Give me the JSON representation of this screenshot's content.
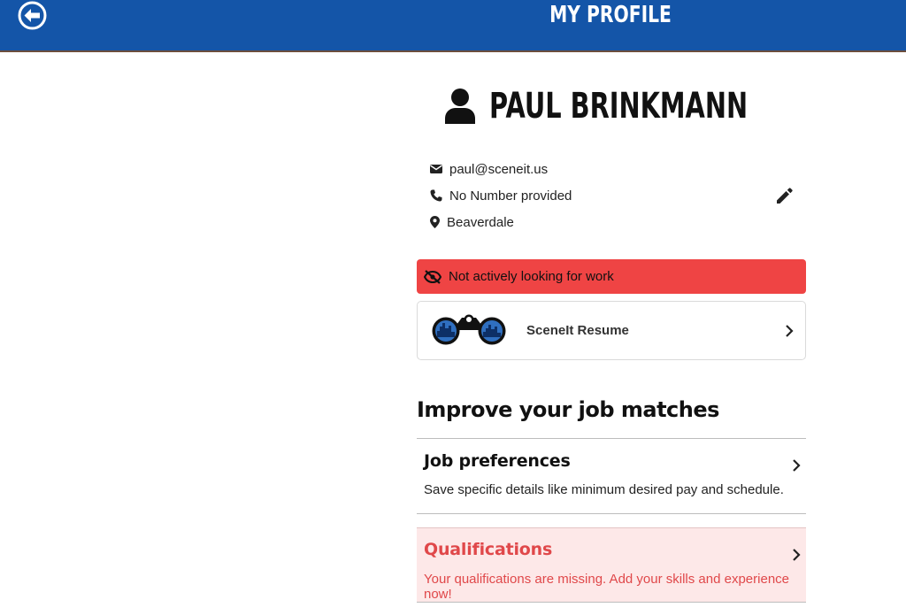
{
  "header": {
    "title": "MY PROFILE"
  },
  "profile": {
    "name": "PAUL BRINKMANN",
    "email": "paul@sceneit.us",
    "phone": "No Number provided",
    "location": "Beaverdale"
  },
  "status": {
    "label": "Not actively looking for work",
    "color": "#ef4444"
  },
  "resume": {
    "label": "SceneIt Resume"
  },
  "improve": {
    "title": "Improve your job matches",
    "items": [
      {
        "title": "Job preferences",
        "description": "Save specific details like minimum desired pay and schedule."
      },
      {
        "title": "Qualifications",
        "description": "Your qualifications are missing. Add your skills and experience now!",
        "warning_color": "#e0484a"
      }
    ]
  },
  "colors": {
    "brand": "#1455a8",
    "warning_bg": "#fde8e8"
  },
  "icons": [
    "back-arrow-icon",
    "person-icon",
    "envelope-icon",
    "phone-icon",
    "map-pin-icon",
    "pencil-icon",
    "eye-slash-icon",
    "binoculars-icon",
    "chevron-right-icon"
  ]
}
